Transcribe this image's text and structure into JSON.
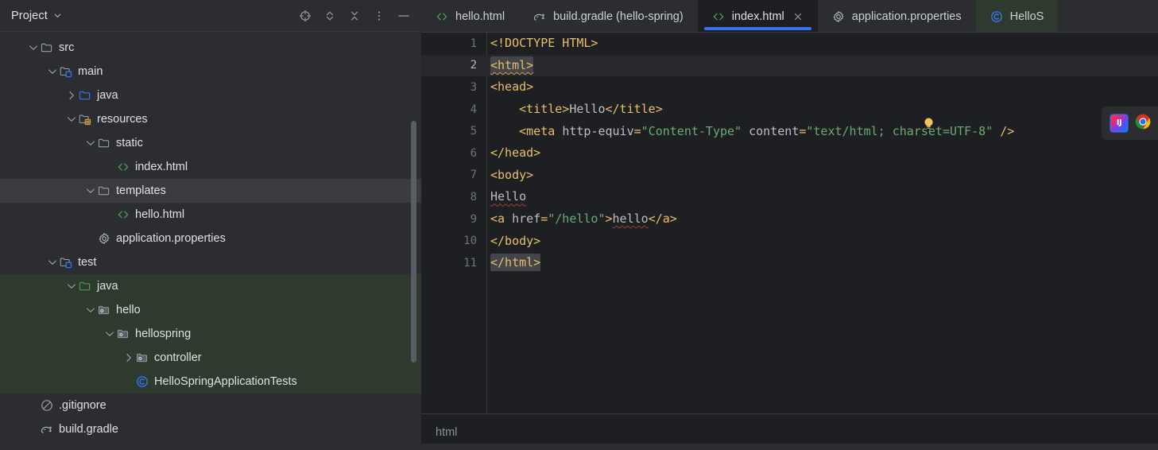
{
  "project_panel": {
    "title": "Project",
    "chevron_icon": "chevron-down-icon",
    "actions": [
      {
        "name": "select-opened-file-button",
        "icon": "crosshair-icon"
      },
      {
        "name": "expand-collapse-button",
        "icon": "chevrons-updown-icon"
      },
      {
        "name": "collapse-all-button",
        "icon": "collapse-all-icon"
      },
      {
        "name": "more-options-button",
        "icon": "vertical-dots-icon"
      },
      {
        "name": "hide-panel-button",
        "icon": "minimize-icon"
      }
    ],
    "tree": [
      {
        "label": "src",
        "depth": 1,
        "arrow": "down",
        "icon": "folder-icon",
        "state": "normal"
      },
      {
        "label": "main",
        "depth": 2,
        "arrow": "down",
        "icon": "source-root-folder-icon",
        "state": "normal"
      },
      {
        "label": "java",
        "depth": 3,
        "arrow": "right",
        "icon": "blue-folder-icon",
        "state": "normal"
      },
      {
        "label": "resources",
        "depth": 3,
        "arrow": "down",
        "icon": "resource-root-folder-icon",
        "state": "normal"
      },
      {
        "label": "static",
        "depth": 4,
        "arrow": "down",
        "icon": "folder-icon",
        "state": "normal"
      },
      {
        "label": "index.html",
        "depth": 5,
        "arrow": "none",
        "icon": "html-file-icon",
        "state": "normal"
      },
      {
        "label": "templates",
        "depth": 4,
        "arrow": "down",
        "icon": "folder-icon",
        "state": "selected"
      },
      {
        "label": "hello.html",
        "depth": 5,
        "arrow": "none",
        "icon": "html-file-icon",
        "state": "normal"
      },
      {
        "label": "application.properties",
        "depth": 4,
        "arrow": "none",
        "icon": "gear-file-icon",
        "state": "normal"
      },
      {
        "label": "test",
        "depth": 2,
        "arrow": "down",
        "icon": "test-root-folder-icon",
        "state": "normal"
      },
      {
        "label": "java",
        "depth": 3,
        "arrow": "down",
        "icon": "green-folder-icon",
        "state": "testbg"
      },
      {
        "label": "hello",
        "depth": 4,
        "arrow": "down",
        "icon": "package-icon",
        "state": "testbg"
      },
      {
        "label": "hellospring",
        "depth": 5,
        "arrow": "down",
        "icon": "package-icon",
        "state": "testbg"
      },
      {
        "label": "controller",
        "depth": 6,
        "arrow": "right",
        "icon": "package-icon",
        "state": "testbg"
      },
      {
        "label": "HelloSpringApplicationTests",
        "depth": 6,
        "arrow": "none",
        "icon": "java-class-icon",
        "state": "testbg"
      },
      {
        "label": ".gitignore",
        "depth": 1,
        "arrow": "none",
        "icon": "gitignore-icon",
        "state": "normal"
      },
      {
        "label": "build.gradle",
        "depth": 1,
        "arrow": "none",
        "icon": "gradle-icon",
        "state": "normal"
      }
    ]
  },
  "editor": {
    "tabs": [
      {
        "label": "hello.html",
        "icon": "html-file-icon",
        "active": false,
        "closable": false,
        "green": false
      },
      {
        "label": "build.gradle (hello-spring)",
        "icon": "gradle-icon",
        "active": false,
        "closable": false,
        "green": false
      },
      {
        "label": "index.html",
        "icon": "html-file-icon",
        "active": true,
        "closable": true,
        "green": false
      },
      {
        "label": "application.properties",
        "icon": "gear-file-icon",
        "active": false,
        "closable": false,
        "green": false
      },
      {
        "label": "HelloS",
        "icon": "java-class-icon",
        "active": false,
        "closable": false,
        "green": true
      }
    ],
    "close_icon": "close-icon",
    "lines": [
      {
        "n": "1",
        "current": false
      },
      {
        "n": "2",
        "current": true
      },
      {
        "n": "3",
        "current": false
      },
      {
        "n": "4",
        "current": false
      },
      {
        "n": "5",
        "current": false
      },
      {
        "n": "6",
        "current": false
      },
      {
        "n": "7",
        "current": false
      },
      {
        "n": "8",
        "current": false
      },
      {
        "n": "9",
        "current": false
      },
      {
        "n": "10",
        "current": false
      },
      {
        "n": "11",
        "current": false
      }
    ],
    "source_text": [
      "<!DOCTYPE HTML>",
      "<html>",
      "<head>",
      "    <title>Hello</title>",
      "    <meta http-equiv=\"Content-Type\" content=\"text/html; charset=UTF-8\" />",
      "</head>",
      "<body>",
      "Hello",
      "<a href=\"/hello\">hello</a>",
      "</body>",
      "</html>"
    ],
    "lightbulb_icon": "intention-bulb-icon",
    "preview_widget": {
      "intellij_icon": "intellij-idea-icon",
      "intellij_label": "IJ",
      "chrome_icon": "chrome-browser-icon"
    },
    "breadcrumb": "html"
  },
  "colors": {
    "accent_blue": "#3574f0",
    "tag": "#e8bf6a",
    "attr_value": "#6aab73",
    "text": "#bcbec4",
    "editor_bg": "#1e1f22",
    "panel_bg": "#2b2d30",
    "test_root_bg": "#2d3a2d",
    "selection_bg": "#393b40"
  }
}
